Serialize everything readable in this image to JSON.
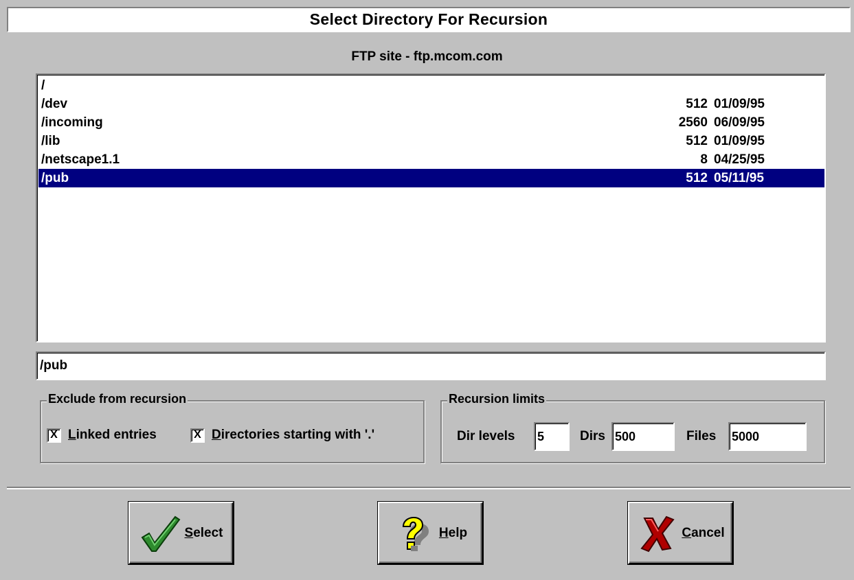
{
  "dialog": {
    "title": "Select Directory For Recursion",
    "subtitle": "FTP site - ftp.mcom.com"
  },
  "directories": [
    {
      "name": "/",
      "size": "",
      "date": ""
    },
    {
      "name": "/dev",
      "size": "512",
      "date": "01/09/95"
    },
    {
      "name": "/incoming",
      "size": "2560",
      "date": "06/09/95"
    },
    {
      "name": "/lib",
      "size": "512",
      "date": "01/09/95"
    },
    {
      "name": "/netscape1.1",
      "size": "8",
      "date": "04/25/95"
    },
    {
      "name": "/pub",
      "size": "512",
      "date": "05/11/95",
      "selected": true
    }
  ],
  "path_field": {
    "value": "/pub"
  },
  "exclude": {
    "legend": "Exclude from recursion",
    "linked": {
      "checked": "X",
      "label_u": "L",
      "label_rest": "inked entries"
    },
    "dotdirs": {
      "checked": "X",
      "label_u": "D",
      "label_rest": "irectories starting with '.'"
    }
  },
  "limits": {
    "legend": "Recursion limits",
    "dir_levels_label": "Dir levels",
    "dir_levels_value": "5",
    "dirs_label": "Dirs",
    "dirs_value": "500",
    "files_label": "Files",
    "files_value": "5000"
  },
  "buttons": {
    "select": {
      "u": "S",
      "rest": "elect"
    },
    "help": {
      "u": "H",
      "rest": "elp"
    },
    "cancel": {
      "u": "C",
      "rest": "ancel"
    }
  },
  "icons": {
    "select": "checkmark-icon",
    "help": "question-mark-icon",
    "cancel": "x-mark-icon"
  },
  "colors": {
    "face": "#c0c0c0",
    "selection": "#000080",
    "check_green": "#2e8b2e",
    "help_yellow": "#ffff00",
    "cancel_red": "#b00000"
  }
}
